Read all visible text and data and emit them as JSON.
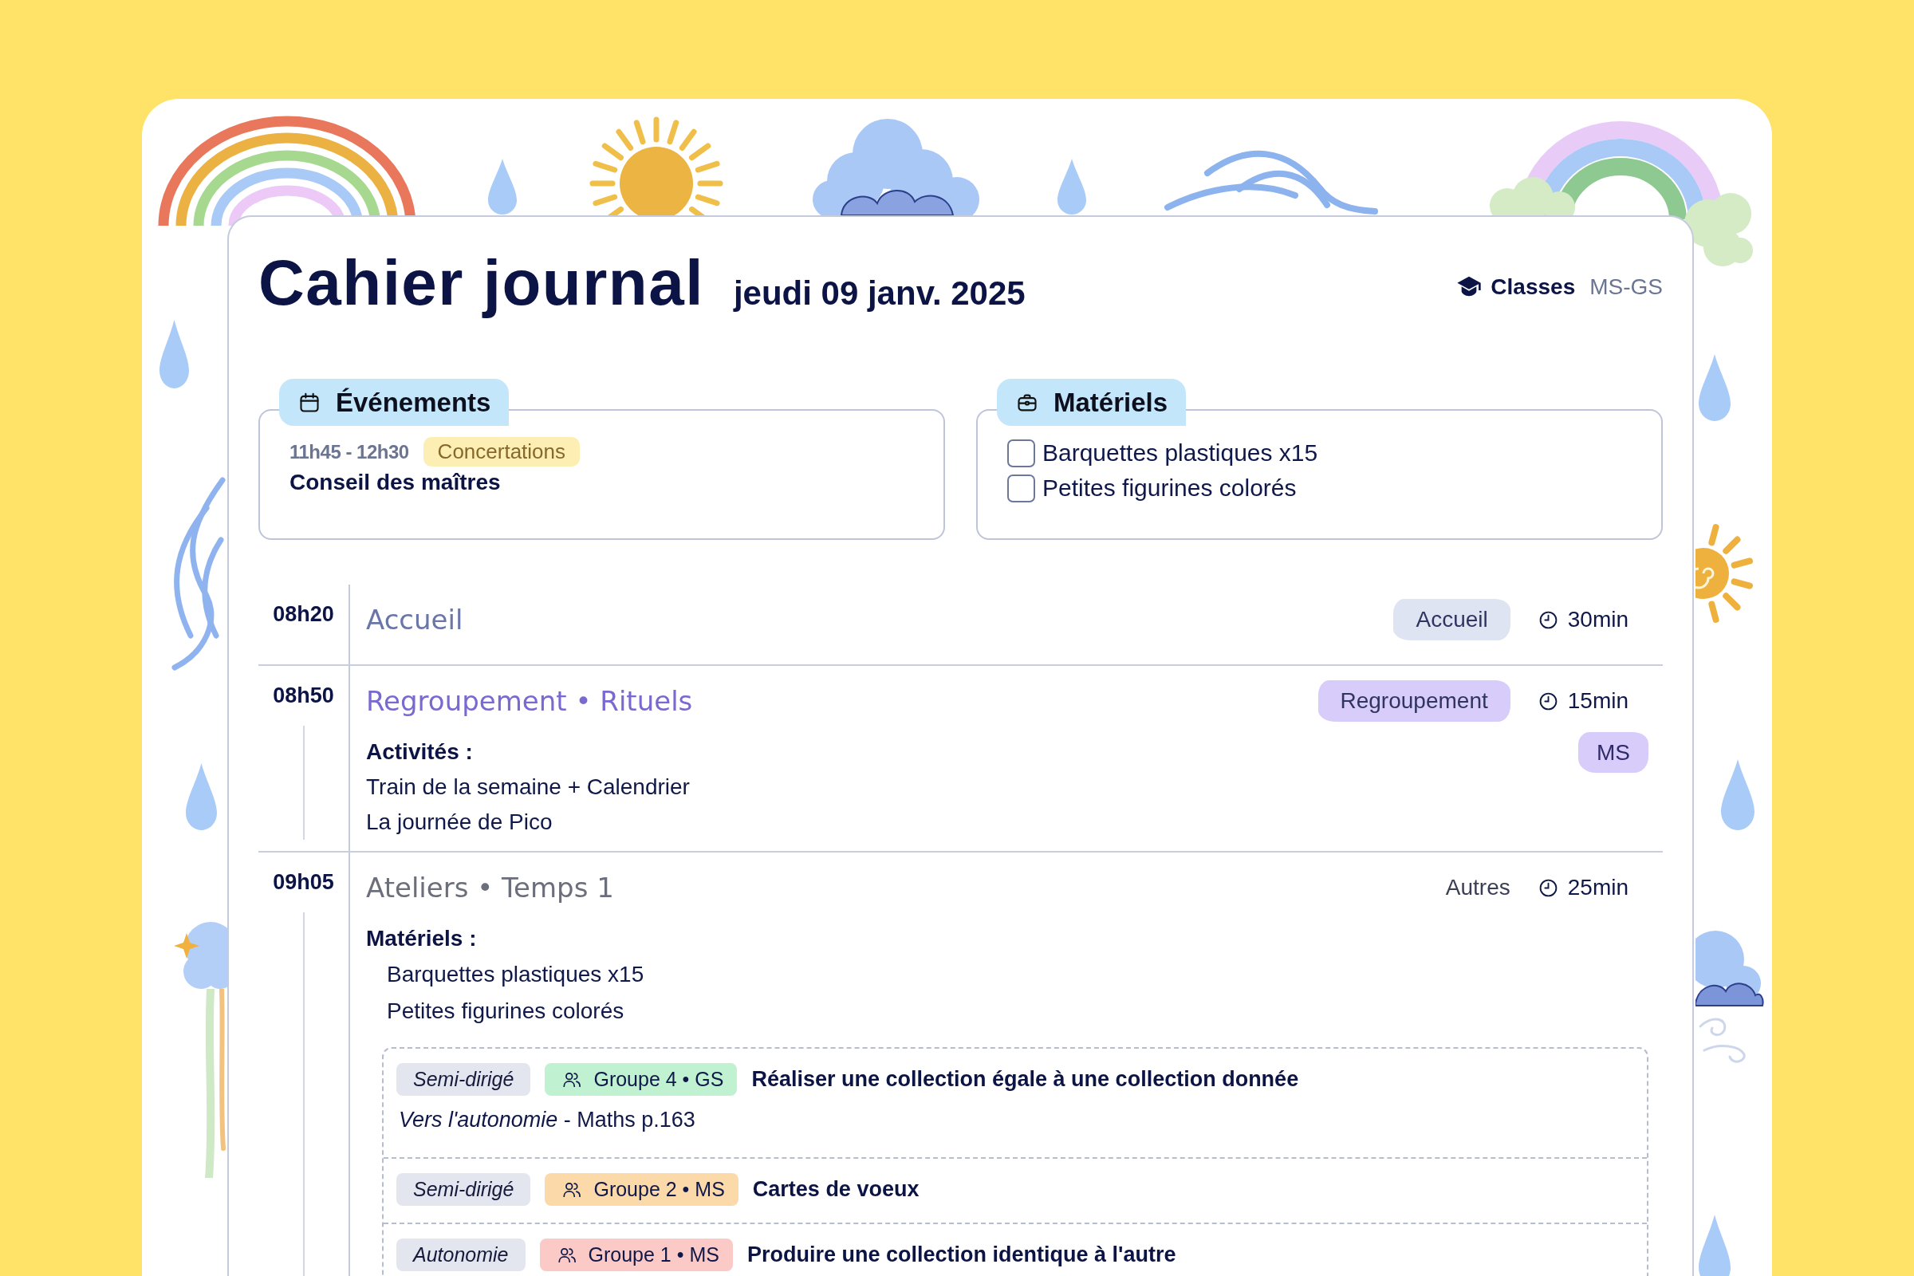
{
  "header": {
    "title": "Cahier journal",
    "date": "jeudi 09 janv. 2025",
    "classes_label": "Classes",
    "classes_value": "MS-GS"
  },
  "events": {
    "title": "Événements",
    "items": [
      {
        "time": "11h45 - 12h30",
        "tag": "Concertations",
        "name": "Conseil des maîtres"
      }
    ]
  },
  "materials": {
    "title": "Matériels",
    "items": [
      {
        "label": "Barquettes plastiques x15",
        "checked": false
      },
      {
        "label": "Petites figurines colorés",
        "checked": false
      }
    ]
  },
  "schedule": [
    {
      "time": "08h20",
      "title": "Accueil",
      "color": "#6a76a8",
      "category": {
        "label": "Accueil",
        "color": "#dfe4f3"
      },
      "duration": "30min"
    },
    {
      "time": "08h50",
      "title": "Regroupement • Rituels",
      "color": "#7a69d0",
      "category": {
        "label": "Regroupement",
        "color": "#d8ccfb"
      },
      "duration": "15min",
      "class_tags": [
        {
          "label": "MS",
          "color": "#d8ccfb"
        }
      ],
      "sections": [
        {
          "kind": "activities",
          "heading": "Activités :",
          "items": [
            "Train de la semaine + Calendrier",
            "La journée de Pico"
          ]
        }
      ]
    },
    {
      "time": "09h05",
      "title": "Ateliers • Temps 1",
      "color": "#6b6e7b",
      "category": {
        "label": "Autres"
      },
      "duration": "25min",
      "sections": [
        {
          "kind": "materials",
          "heading": "Matériels :",
          "items": [
            "Barquettes plastiques x15",
            "Petites figurines colorés"
          ]
        }
      ],
      "ateliers": [
        {
          "mode": "Semi-dirigé",
          "group": "Groupe 4 • GS",
          "color": "#c0f2d1",
          "title": "Réaliser une collection égale à une collection donnée",
          "note": "*Vers l'autonomie* - Maths p.163"
        },
        {
          "mode": "Semi-dirigé",
          "group": "Groupe 2 • MS",
          "color": "#fcd9a9",
          "title": "Cartes de voeux"
        },
        {
          "mode": "Autonomie",
          "group": "Groupe 1 • MS",
          "color": "#fbcac7",
          "title": "Produire une collection identique à l'autre"
        }
      ]
    }
  ]
}
